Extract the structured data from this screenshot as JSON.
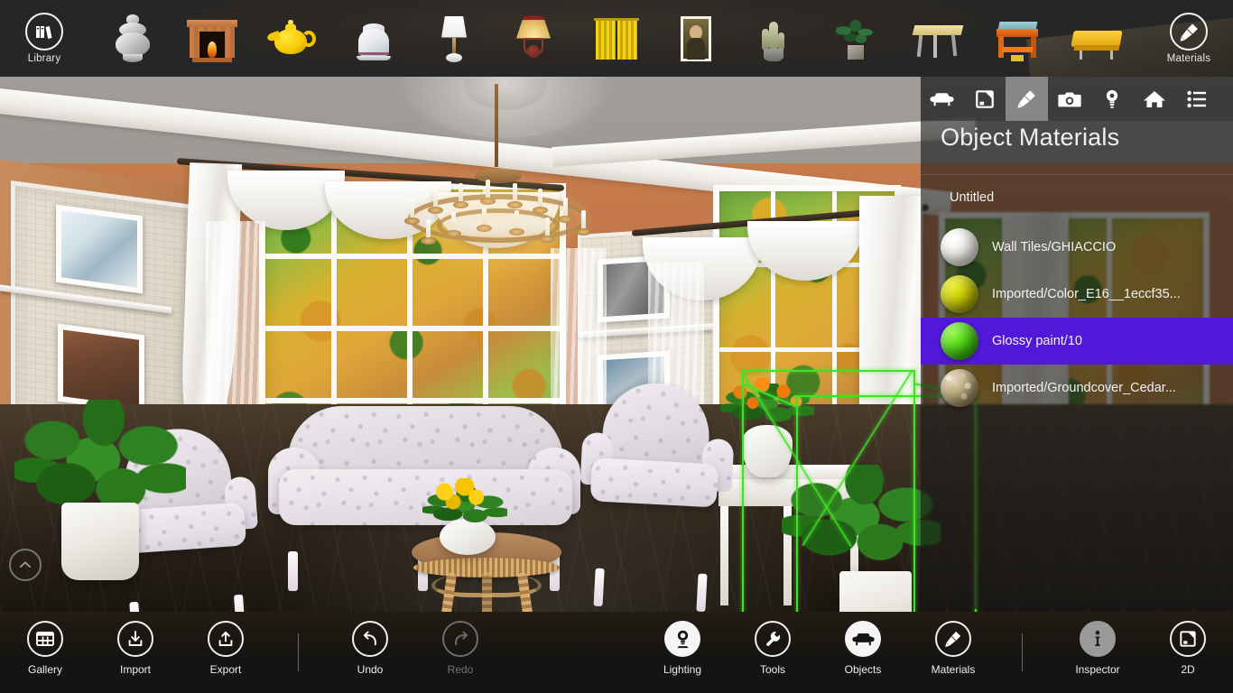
{
  "top_toolbar": {
    "library": {
      "label": "Library",
      "icon": "library-books-icon"
    },
    "materials": {
      "label": "Materials",
      "icon": "paintbrush-icon"
    },
    "objects": [
      {
        "name": "silver-vase-thumbnail"
      },
      {
        "name": "fireplace-thumbnail"
      },
      {
        "name": "yellow-teapot-thumbnail"
      },
      {
        "name": "white-jug-thumbnail"
      },
      {
        "name": "table-lamp-thumbnail"
      },
      {
        "name": "shaded-lamp-thumbnail"
      },
      {
        "name": "yellow-curtains-thumbnail"
      },
      {
        "name": "mona-lisa-painting-thumbnail"
      },
      {
        "name": "cactus-plant-thumbnail"
      },
      {
        "name": "potted-plant-thumbnail"
      },
      {
        "name": "wooden-table-thumbnail"
      },
      {
        "name": "orange-stool-thumbnail"
      },
      {
        "name": "yellow-sofa-thumbnail"
      }
    ]
  },
  "viewport": {
    "collapse_button": "chevron-up-icon",
    "selected_object": "potted-plant",
    "selection_color": "#41e026"
  },
  "panel": {
    "tabs": [
      {
        "name": "objects-tab",
        "icon": "sofa-icon",
        "active": false
      },
      {
        "name": "floorplan-tab",
        "icon": "floorplan-icon",
        "active": false
      },
      {
        "name": "materials-tab",
        "icon": "paintbrush-icon",
        "active": true
      },
      {
        "name": "camera-tab",
        "icon": "camera-icon",
        "active": false
      },
      {
        "name": "lighting-tab",
        "icon": "bulb-icon",
        "active": false
      },
      {
        "name": "home-tab",
        "icon": "home-icon",
        "active": false
      },
      {
        "name": "list-tab",
        "icon": "list-icon",
        "active": false
      }
    ],
    "title": "Object Materials",
    "subtitle": "Untitled",
    "selected_highlight_color": "#5218d8",
    "materials": [
      {
        "name": "Wall Tiles/GHIACCIO",
        "color": "#f2f0ec",
        "selected": false
      },
      {
        "name": "Imported/Color_E16__1eccf35...",
        "color": "#b9ba05",
        "selected": false
      },
      {
        "name": "Glossy paint/10",
        "color": "#4cd614",
        "selected": true
      },
      {
        "name": "Imported/Groundcover_Cedar...",
        "color": "#c6b489",
        "selected": false
      }
    ]
  },
  "bottom_bar": {
    "items": [
      {
        "label": "Gallery",
        "icon": "gallery-grid-icon",
        "style": "outline",
        "enabled": true
      },
      {
        "label": "Import",
        "icon": "import-arrow-icon",
        "style": "outline",
        "enabled": true
      },
      {
        "label": "Export",
        "icon": "export-arrow-icon",
        "style": "outline",
        "enabled": true
      },
      {
        "label": "Undo",
        "icon": "undo-arrow-icon",
        "style": "outline",
        "enabled": true
      },
      {
        "label": "Redo",
        "icon": "redo-arrow-icon",
        "style": "dim",
        "enabled": false
      },
      {
        "label": "Lighting",
        "icon": "bulb-icon",
        "style": "filled",
        "enabled": true
      },
      {
        "label": "Tools",
        "icon": "wrench-icon",
        "style": "outline",
        "enabled": true
      },
      {
        "label": "Objects",
        "icon": "sofa-icon",
        "style": "filled",
        "enabled": true
      },
      {
        "label": "Materials",
        "icon": "paintbrush-icon",
        "style": "outline",
        "enabled": true
      },
      {
        "label": "Inspector",
        "icon": "info-icon",
        "style": "grey",
        "enabled": true
      },
      {
        "label": "2D",
        "icon": "floorplan-icon",
        "style": "outline",
        "enabled": true
      }
    ]
  }
}
